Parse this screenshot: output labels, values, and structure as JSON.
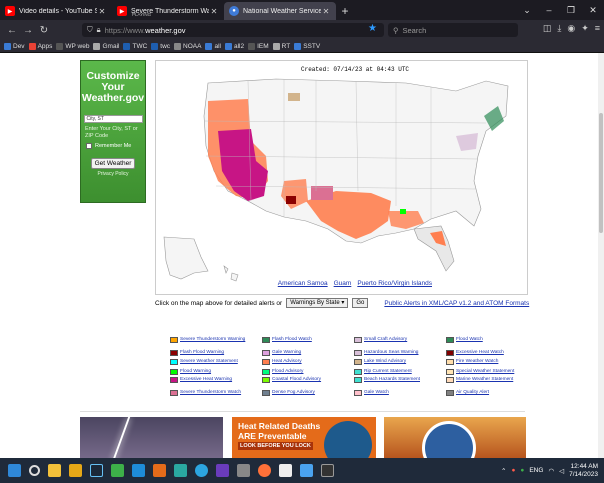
{
  "browser": {
    "tabs": [
      {
        "label": "Video details - YouTube Studio",
        "sub": "",
        "icon_color": "#ff0000",
        "active": false
      },
      {
        "label": "Severe Thunderstorm Warning",
        "sub": "PLAYING",
        "icon_color": "#ff0000",
        "active": false
      },
      {
        "label": "National Weather Service",
        "sub": "",
        "icon_color": "#3f7bd8",
        "active": true
      }
    ],
    "new_tab": "+",
    "url_scheme": "https://www.",
    "url_host": "weather.gov",
    "search_placeholder": "Search",
    "bookmarks": [
      "Dev",
      "Apps",
      "WP web",
      "Gmail",
      "TWC",
      "twc",
      "NOAA",
      "all",
      "all2",
      "IEM",
      "RT",
      "SSTV"
    ]
  },
  "customize": {
    "title": "Customize Your Weather.gov",
    "city_value": "City, ST",
    "hint": "Enter Your City, ST or ZIP Code",
    "remember": "Remember Me",
    "button": "Get Weather",
    "privacy": "Privacy Policy"
  },
  "map": {
    "created": "Created: 07/14/23 at 04:43 UTC",
    "links": [
      "American Samoa",
      "Guam",
      "Puerto Rico/Virgin Islands"
    ]
  },
  "controls": {
    "click_text": "Click on the map above for detailed alerts or",
    "select_value": "Warnings By State",
    "go": "Go",
    "xml_link": "Public Alerts in XML/CAP v1.2 and ATOM Formats"
  },
  "legend": [
    {
      "label": "Severe Thunderstorm Warning",
      "color": "#ffa500"
    },
    {
      "label": "Flash Flood Warning",
      "color": "#8b0000"
    },
    {
      "label": "Severe Weather Statement",
      "color": "#00ffff"
    },
    {
      "label": "Flood Warning",
      "color": "#00ff00"
    },
    {
      "label": "Excessive Heat Warning",
      "color": "#c71585"
    },
    {
      "label": "Severe Thunderstorm Watch",
      "color": "#db7093"
    },
    {
      "label": "Flash Flood Watch",
      "color": "#2e8b57"
    },
    {
      "label": "Gale Warning",
      "color": "#dda0dd"
    },
    {
      "label": "Heat Advisory",
      "color": "#ff7f50"
    },
    {
      "label": "Flood Advisory",
      "color": "#00ff7f"
    },
    {
      "label": "Coastal Flood Advisory",
      "color": "#7cfc00"
    },
    {
      "label": "Dense Fog Advisory",
      "color": "#708090"
    },
    {
      "label": "Small Craft Advisory",
      "color": "#d8bfd8"
    },
    {
      "label": "Hazardous Seas Warning",
      "color": "#d8bfd8"
    },
    {
      "label": "Lake Wind Advisory",
      "color": "#d2b48c"
    },
    {
      "label": "Rip Current Statement",
      "color": "#40e0d0"
    },
    {
      "label": "Beach Hazards Statement",
      "color": "#40e0d0"
    },
    {
      "label": "Gale Watch",
      "color": "#ffc0cb"
    },
    {
      "label": "Flood Watch",
      "color": "#2e8b57"
    },
    {
      "label": "Excessive Heat Watch",
      "color": "#800000"
    },
    {
      "label": "Fire Weather Watch",
      "color": "#ffdead"
    },
    {
      "label": "Special Weather Statement",
      "color": "#ffe4b5"
    },
    {
      "label": "Marine Weather Statement",
      "color": "#ffdab9"
    },
    {
      "label": "Air Quality Alert",
      "color": "#808080"
    }
  ],
  "promos": {
    "heat_title1": "Heat Related Deaths",
    "heat_title2": "ARE Preventable",
    "heat_sub": "LOOK BEFORE YOU LOCK"
  },
  "taskbar": {
    "lang": "ENG",
    "time": "12:44 AM",
    "date": "7/14/2023"
  }
}
